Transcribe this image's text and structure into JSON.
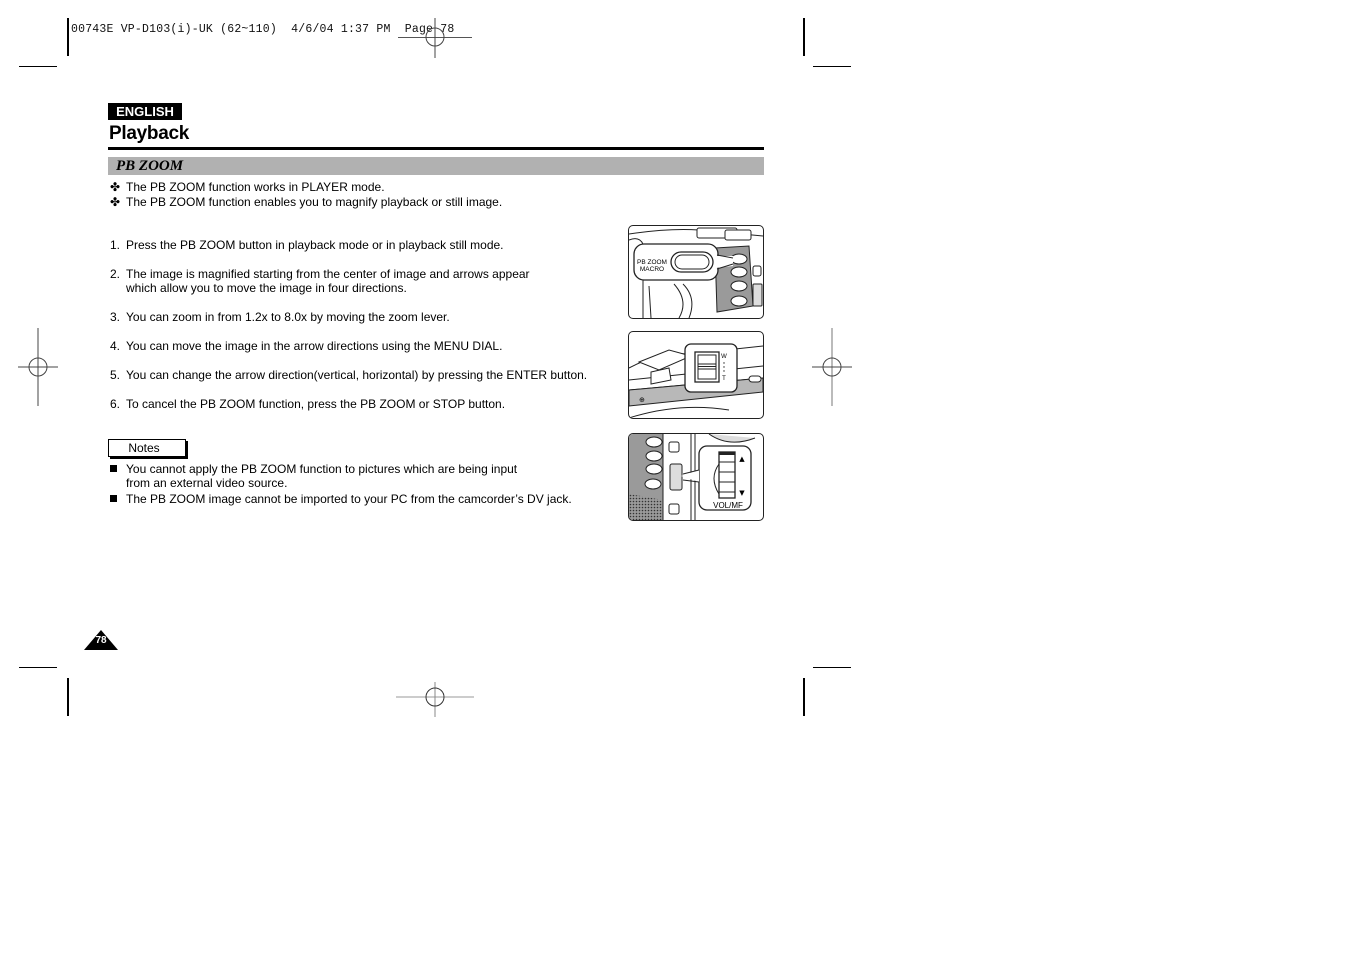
{
  "print_slug": "00743E VP-D103(i)-UK (62~110)  4/6/04 1:37 PM  Page 78",
  "header": {
    "language_badge": "ENGLISH",
    "section_title": "Playback",
    "subsection_title": "PB ZOOM"
  },
  "intro_bullets": {
    "marker": "✤",
    "items": [
      "The PB ZOOM function works in PLAYER mode.",
      "The PB ZOOM function enables you to magnify playback or still image."
    ]
  },
  "steps": [
    {
      "num": "1.",
      "lines": [
        "Press the PB ZOOM button in playback mode or in playback still mode."
      ]
    },
    {
      "num": "2.",
      "lines": [
        "The image is magnified starting from the center of image and arrows appear",
        "which allow you to move the image in four directions."
      ]
    },
    {
      "num": "3.",
      "lines": [
        "You can zoom in from 1.2x to 8.0x by moving the zoom lever."
      ]
    },
    {
      "num": "4.",
      "lines": [
        "You can move the image in the arrow directions using the MENU DIAL."
      ]
    },
    {
      "num": "5.",
      "lines": [
        "You can change the arrow direction(vertical, horizontal) by pressing the ENTER button."
      ]
    },
    {
      "num": "6.",
      "lines": [
        "To cancel the PB ZOOM function, press the PB ZOOM or STOP button."
      ]
    }
  ],
  "notes": {
    "label": "Notes",
    "items": [
      {
        "lines": [
          "You cannot apply the PB ZOOM function to pictures which are being input",
          "from an external video source."
        ]
      },
      {
        "lines": [
          "The PB ZOOM image cannot be imported to your PC from the camcorder’s DV jack."
        ]
      }
    ]
  },
  "illustrations": [
    {
      "name": "pb-zoom-button-illustration",
      "callout_line1": "PB ZOOM",
      "callout_line2": "MACRO"
    },
    {
      "name": "zoom-lever-illustration",
      "label_w": "W",
      "label_t": "T"
    },
    {
      "name": "vol-mf-dial-illustration",
      "label": "VOL/MF",
      "arrow_up": "▲",
      "arrow_down": "▼"
    }
  ],
  "page_number": "78"
}
